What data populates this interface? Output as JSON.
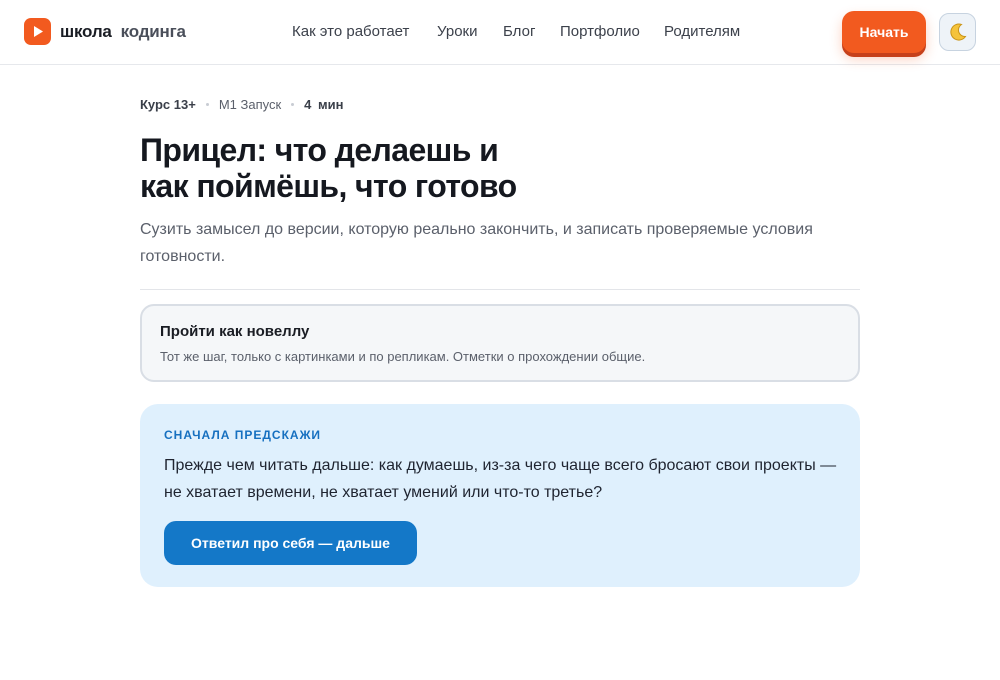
{
  "brand": {
    "part1": "школа",
    "part2": "кодинга"
  },
  "nav": {
    "items": [
      {
        "label": "Как это работает"
      },
      {
        "label": "Уроки"
      },
      {
        "label": "Блог"
      },
      {
        "label": "Портфолио"
      },
      {
        "label": "Родителям"
      }
    ]
  },
  "header": {
    "start_label": "Начать",
    "theme_icon": "moon-icon"
  },
  "lesson": {
    "course": "Курс 13+",
    "module": "М1 Запуск",
    "duration": "4 мин",
    "title_line1": "Прицел: что делаешь и",
    "title_line2": "как поймёшь, что готово",
    "subtitle": "Сузить замысел до версии, которую реально закончить, и записать проверяемые условия готовности."
  },
  "novel_card": {
    "title": "Пройти как новеллу",
    "description": "Тот же шаг, только с картинками и по репликам. Отметки о прохождении общие."
  },
  "predict": {
    "label": "СНАЧАЛА ПРЕДСКАЖИ",
    "question": "Прежде чем читать дальше: как думаешь, из-за чего чаще всего бросают свои проекты — не хватает времени, не хватает умений или что-то третье?",
    "button_label": "Ответил про себя — дальше"
  },
  "colors": {
    "accent_orange": "#f25a1f",
    "accent_blue": "#1478c8",
    "predict_bg": "#dff0fd"
  }
}
